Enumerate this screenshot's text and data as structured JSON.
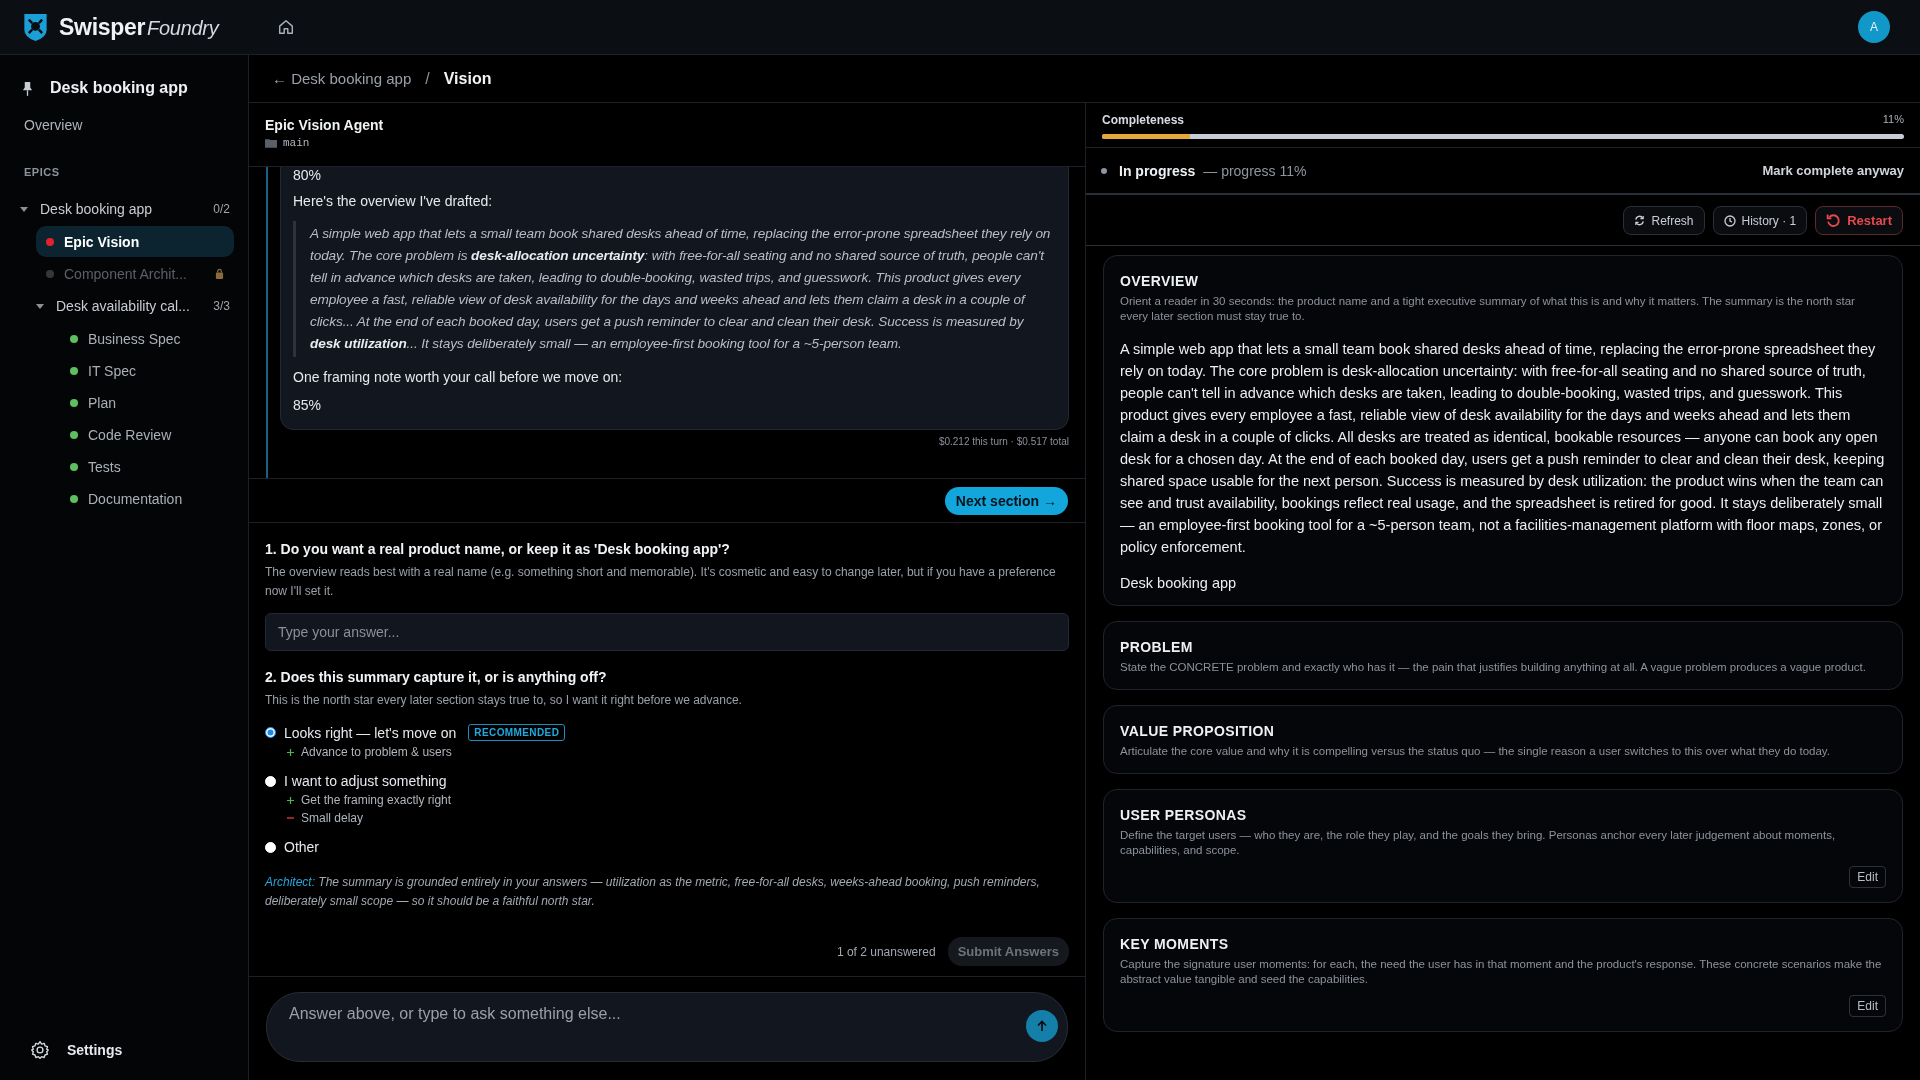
{
  "header": {
    "brand": "Swisper",
    "brand_suffix": "Foundry",
    "avatar": "A"
  },
  "sidebar": {
    "project": "Desk booking app",
    "overview": "Overview",
    "section_label": "EPICS",
    "tree": [
      {
        "kind": "group",
        "label": "Desk booking app",
        "count": "0/2",
        "expanded": true,
        "children": [
          {
            "kind": "step",
            "label": "Epic Vision",
            "color": "#e5202a",
            "selected": true,
            "locked": false
          },
          {
            "kind": "step",
            "label": "Component Archit...",
            "color": "#34373c",
            "selected": false,
            "locked": true
          },
          {
            "kind": "group",
            "label": "Desk availability cal...",
            "count": "3/3",
            "expanded": true,
            "children": [
              {
                "kind": "step",
                "label": "Business Spec",
                "color": "#5fbf5f",
                "selected": false,
                "locked": false
              },
              {
                "kind": "step",
                "label": "IT Spec",
                "color": "#5fbf5f",
                "selected": false,
                "locked": false
              },
              {
                "kind": "step",
                "label": "Plan",
                "color": "#5fbf5f",
                "selected": false,
                "locked": false
              },
              {
                "kind": "step",
                "label": "Code Review",
                "color": "#5fbf5f",
                "selected": false,
                "locked": false
              },
              {
                "kind": "step",
                "label": "Tests",
                "color": "#5fbf5f",
                "selected": false,
                "locked": false
              },
              {
                "kind": "step",
                "label": "Documentation",
                "color": "#5fbf5f",
                "selected": false,
                "locked": false
              }
            ]
          }
        ]
      }
    ],
    "settings": "Settings"
  },
  "breadcrumb": {
    "back": "← Desk booking app",
    "separator": "/",
    "current": "Vision"
  },
  "agent": {
    "name": "Epic Vision Agent",
    "branch": "main"
  },
  "chat": {
    "messages": [
      {
        "kind": "text",
        "text": "80%"
      },
      {
        "kind": "text",
        "text": "Here's the overview I've drafted:"
      },
      {
        "kind": "quote",
        "text": "A simple web app that lets a small team book shared desks ahead of time, replacing the error-prone spreadsheet they rely on today. The core problem is **desk-allocation uncertainty**: with free-for-all seating and no shared source of truth, people can't tell in advance which desks are taken, leading to double-booking, wasted trips, and guesswork. This product gives every employee a fast, reliable view of desk availability for the days and weeks ahead and lets them claim a desk in a couple of clicks... At the end of each booked day, users get a push reminder to clear and clean their desk. Success is measured by **desk utilization**... It stays deliberately small — an employee-first booking tool for a ~5-person team."
      },
      {
        "kind": "text",
        "text": "One framing note worth your call before we move on:"
      },
      {
        "kind": "text",
        "text": "85%"
      }
    ],
    "cost": "$0.212 this turn · $0.517 total",
    "next_button": "Next section →"
  },
  "questions": [
    {
      "kind": "text",
      "title": "1. Do you want a real product name, or keep it as 'Desk booking app'?",
      "hint": "The overview reads best with a real name (e.g. something short and memorable). It's cosmetic and easy to change later, but if you have a preference now I'll set it.",
      "placeholder": "Type your answer..."
    },
    {
      "kind": "choice",
      "title": "2. Does this summary capture it, or is anything off?",
      "hint": "This is the north star every later section stays true to, so I want it right before we advance.",
      "options": [
        {
          "label": "Looks right — let's move on",
          "selected": true,
          "badge": "RECOMMENDED",
          "notes": [
            {
              "kind": "pro",
              "text": "Advance to problem & users"
            }
          ]
        },
        {
          "label": "I want to adjust something",
          "selected": false,
          "notes": [
            {
              "kind": "pro",
              "text": "Get the framing exactly right"
            },
            {
              "kind": "con",
              "text": "Small delay"
            }
          ]
        },
        {
          "label": "Other",
          "selected": false
        }
      ]
    }
  ],
  "architect": {
    "label": "Architect:",
    "text": "The summary is grounded entirely in your answers — utilization as the metric, free-for-all desks, weeks-ahead booking, push reminders, deliberately small scope — so it should be a faithful north star."
  },
  "answers_footer": {
    "status": "1 of 2 unanswered",
    "submit": "Submit Answers",
    "disabled": true
  },
  "composer": {
    "placeholder": "Answer above, or type to ask something else..."
  },
  "completeness": {
    "label": "Completeness",
    "reading": "11%",
    "level": 0.11
  },
  "status": {
    "label": "In progress",
    "detail": "— progress 11%",
    "action": "Mark complete anyway"
  },
  "toolbar": [
    {
      "kind": "refresh",
      "label": "Refresh"
    },
    {
      "kind": "history",
      "label": "History · 1"
    },
    {
      "kind": "restart",
      "label": "Restart"
    }
  ],
  "sections": [
    {
      "title": "OVERVIEW",
      "hint": "Orient a reader in 30 seconds: the product name and a tight executive summary of what this is and why it matters. The summary is the north star every later section must stay true to.",
      "body": "A simple web app that lets a small team book shared desks ahead of time, replacing the error-prone spreadsheet they rely on today. The core problem is desk-allocation uncertainty: with free-for-all seating and no shared source of truth, people can't tell in advance which desks are taken, leading to double-booking, wasted trips, and guesswork. This product gives every employee a fast, reliable view of desk availability for the days and weeks ahead and lets them claim a desk in a couple of clicks. All desks are treated as identical, bookable resources — anyone can book any open desk for a chosen day. At the end of each booked day, users get a push reminder to clear and clean their desk, keeping shared space usable for the next person. Success is measured by desk utilization: the product wins when the team can see and trust availability, bookings reflect real usage, and the spreadsheet is retired for good. It stays deliberately small — an employee-first booking tool for a ~5-person team, not a facilities-management platform with floor maps, zones, or policy enforcement.",
      "name": "Desk booking app"
    },
    {
      "title": "PROBLEM",
      "hint": "State the CONCRETE problem and exactly who has it — the pain that justifies building anything at all. A vague problem produces a vague product."
    },
    {
      "title": "VALUE PROPOSITION",
      "hint": "Articulate the core value and why it is compelling versus the status quo — the single reason a user switches to this over what they do today."
    },
    {
      "title": "USER PERSONAS",
      "hint": "Define the target users — who they are, the role they play, and the goals they bring. Personas anchor every later judgement about moments, capabilities, and scope.",
      "action": "Edit"
    },
    {
      "title": "KEY MOMENTS",
      "hint": "Capture the signature user moments: for each, the need the user has in that moment and the product's response. These concrete scenarios make the abstract value tangible and seed the capabilities.",
      "action": "Edit"
    }
  ]
}
